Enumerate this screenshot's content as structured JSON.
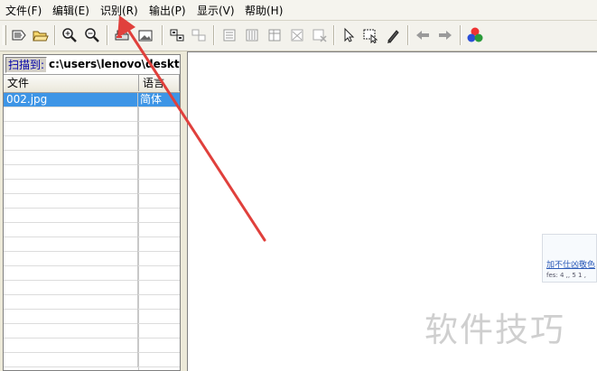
{
  "menu": {
    "items": [
      {
        "label": "文件(F)"
      },
      {
        "label": "编辑(E)"
      },
      {
        "label": "识别(R)"
      },
      {
        "label": "输出(P)"
      },
      {
        "label": "显示(V)"
      },
      {
        "label": "帮助(H)"
      }
    ]
  },
  "toolbar": {
    "icons": [
      "open-scan-icon",
      "open-folder-icon",
      "zoom-in-icon",
      "zoom-out-icon",
      "scan-icon",
      "image-icon",
      "select-region-icon",
      "select-region-disabled-icon",
      "layout-1-icon",
      "layout-2-icon",
      "layout-3-icon",
      "layout-4-icon",
      "delete-region-icon",
      "pointer-icon",
      "recognize-region-icon",
      "pen-icon",
      "back-arrow-icon",
      "forward-arrow-icon",
      "color-icon"
    ]
  },
  "left_panel": {
    "scan_label": "扫描到:",
    "scan_path": "c:\\users\\lenovo\\deskto",
    "columns": [
      "文件",
      "语言"
    ],
    "rows": [
      {
        "file": "002.jpg",
        "lang": "简体",
        "selected": true
      }
    ]
  },
  "preview": {
    "link_text": "加不仕凶敬色",
    "small_text": "fes: 4 ,, 5 1 ,"
  },
  "watermark": "软件技巧",
  "colors": {
    "selection": "#3d95e6",
    "annotation_arrow": "#e0403c",
    "scan_label_text": "#0000a8"
  }
}
